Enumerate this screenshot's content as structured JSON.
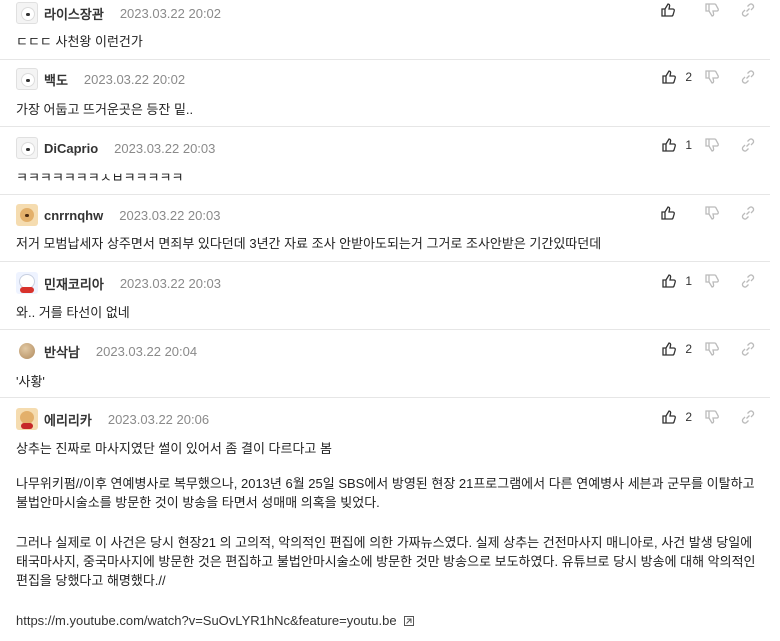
{
  "comments": [
    {
      "nick": "라이스장관",
      "date": "2023.03.22 20:02",
      "text": "ㄷㄷㄷ 사천왕 이런건가",
      "likes": ""
    },
    {
      "nick": "백도",
      "date": "2023.03.22 20:02",
      "text": "가장 어둡고 뜨거운곳은 등잔 밑..",
      "likes": "2"
    },
    {
      "nick": "DiCaprio",
      "date": "2023.03.22 20:03",
      "text": "ㅋㅋㅋㅋㅋㅋㅋㅅㅂㅋㅋㅋㅋㅋ",
      "likes": "1"
    },
    {
      "nick": "cnrrnqhw",
      "date": "2023.03.22 20:03",
      "text": "저거 모범납세자 상주면서 면죄부 있다던데 3년간 자료 조사 안받아도되는거 그거로 조사안받은 기간있따던데",
      "likes": ""
    },
    {
      "nick": "민재코리아",
      "date": "2023.03.22 20:03",
      "text": "와.. 거를 타선이 없네",
      "likes": "1"
    },
    {
      "nick": "반삭남",
      "date": "2023.03.22 20:04",
      "text": "'사황'",
      "likes": "2"
    },
    {
      "nick": "에리리카",
      "date": "2023.03.22 20:06",
      "text": "상추는 진짜로 마사지였단 썰이 있어서 좀 결이 다르다고 봄",
      "likes": "2",
      "para1": "나무위키펌//이후 연예병사로 복무했으나, 2013년 6월 25일 SBS에서 방영된 현장 21프로그램에서 다른 연예병사 세븐과 군무를 이탈하고 불법안마시술소를 방문한 것이 방송을 타면서 성매매 의혹을 빚었다.",
      "para2": "그러나 실제로 이 사건은 당시 현장21 의 고의적, 악의적인 편집에 의한 가짜뉴스였다. 실제 상추는 건전마사지 매니아로, 사건 발생 당일에 태국마사지, 중국마사지에 방문한 것은 편집하고 불법안마시술소에 방문한 것만 방송으로 보도하였다. 유튜브로 당시 방송에 대해 악의적인 편집을 당했다고 해명했다.//",
      "link": "https://m.youtube.com/watch?v=SuOvLYR1hNc&feature=youtu.be"
    }
  ],
  "icons": {
    "like": "thumbs-up-icon",
    "dislike": "thumbs-down-icon",
    "share": "link-icon",
    "external": "external-link-icon"
  }
}
